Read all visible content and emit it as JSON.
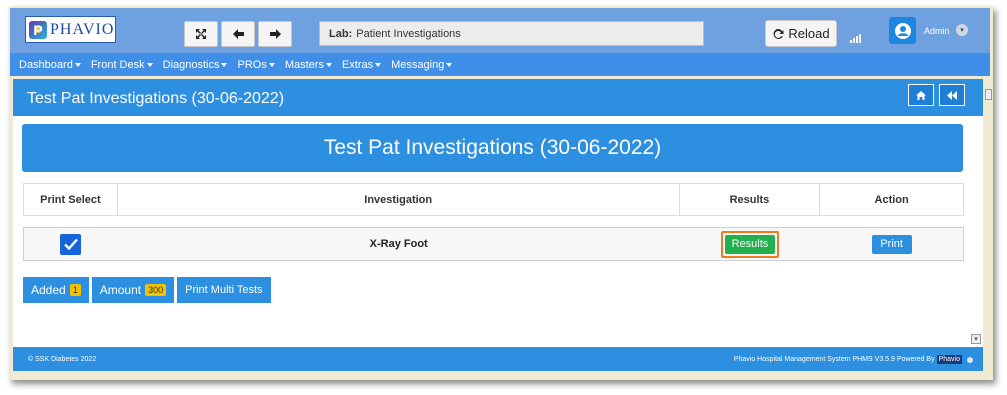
{
  "app": {
    "logo_letter": "P",
    "logo_text": "PHAVIO"
  },
  "toolbar": {
    "fullscreen_icon": "expand-icon",
    "back_icon": "arrow-left-icon",
    "forward_icon": "arrow-right-icon",
    "lab_label": "Lab:",
    "lab_value": "Patient Investigations",
    "reload_label": "Reload",
    "user_name": "Admin"
  },
  "menu": {
    "items": [
      {
        "label": "Dashboard"
      },
      {
        "label": "Front Desk"
      },
      {
        "label": "Diagnostics"
      },
      {
        "label": "PROs"
      },
      {
        "label": "Masters"
      },
      {
        "label": "Extras"
      },
      {
        "label": "Messaging"
      }
    ]
  },
  "panel": {
    "title": "Test Pat Investigations (30-06-2022)",
    "banner_title": "Test Pat Investigations (30-06-2022)",
    "home_icon": "home-icon",
    "back_icon": "backward-icon"
  },
  "table": {
    "headers": [
      "Print Select",
      "Investigation",
      "Results",
      "Action"
    ],
    "rows": [
      {
        "checked": true,
        "investigation": "X-Ray Foot",
        "results_label": "Results",
        "action_label": "Print"
      }
    ]
  },
  "summary": {
    "added_label": "Added",
    "added_count": "1",
    "amount_label": "Amount",
    "amount_value": "300",
    "print_multi_label": "Print Multi Tests"
  },
  "footer": {
    "copyright": "© SSK Diabetes 2022",
    "system_text": "Phavio Hospital Management System PHMS V3.5.9 Powered By",
    "brand": "Phavio"
  },
  "colors": {
    "accent": "#2d8fe0",
    "topbar": "#6fa0df",
    "menubar": "#3f8fe8",
    "results_button": "#22b04e",
    "highlight": "#ee7d1f"
  }
}
